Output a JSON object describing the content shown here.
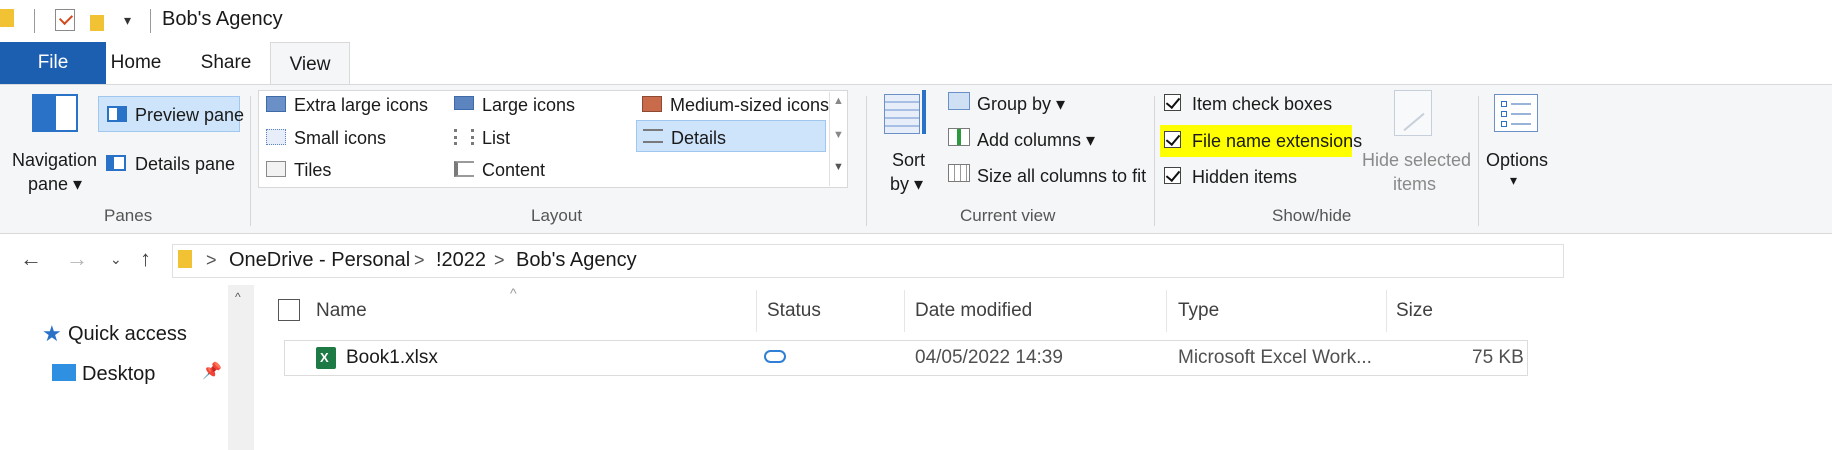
{
  "window": {
    "title": "Bob's Agency"
  },
  "quick_access_toolbar": {
    "dropdown_glyph": "▾"
  },
  "tabs": [
    {
      "label": "File"
    },
    {
      "label": "Home"
    },
    {
      "label": "Share"
    },
    {
      "label": "View"
    }
  ],
  "ribbon": {
    "panes": {
      "label": "Panes",
      "navigation_pane_line1": "Navigation",
      "navigation_pane_line2": "pane ▾",
      "preview_pane": "Preview pane",
      "details_pane": "Details pane"
    },
    "layout": {
      "label": "Layout",
      "items": [
        {
          "label": "Extra large icons"
        },
        {
          "label": "Large icons"
        },
        {
          "label": "Medium-sized icons"
        },
        {
          "label": "Small icons"
        },
        {
          "label": "List"
        },
        {
          "label": "Details",
          "selected": true
        },
        {
          "label": "Tiles"
        },
        {
          "label": "Content"
        }
      ]
    },
    "current_view": {
      "label": "Current view",
      "sort_by_line1": "Sort",
      "sort_by_line2": "by ▾",
      "group_by": "Group by ▾",
      "add_columns": "Add columns ▾",
      "size_all_columns": "Size all columns to fit"
    },
    "show_hide": {
      "label": "Show/hide",
      "item_check_boxes": "Item check boxes",
      "file_name_extensions": "File name extensions",
      "hidden_items": "Hidden items",
      "hide_selected_line1": "Hide selected",
      "hide_selected_line2": "items",
      "highlight_color": "#ffff00"
    },
    "options": {
      "label": "Options",
      "arrow": "▾"
    }
  },
  "address_bar": {
    "crumbs": [
      "OneDrive - Personal",
      "!2022",
      "Bob's Agency"
    ],
    "separator": ">"
  },
  "file_list": {
    "columns": [
      "Name",
      "Status",
      "Date modified",
      "Type",
      "Size"
    ],
    "rows": [
      {
        "name": "Book1.xlsx",
        "status_icon": "cloud-icon",
        "date_modified": "04/05/2022 14:39",
        "type": "Microsoft Excel Work...",
        "size": "75 KB"
      }
    ]
  },
  "sidebar": {
    "items": [
      {
        "label": "Quick access"
      },
      {
        "label": "Desktop"
      }
    ]
  },
  "colors": {
    "file_tab": "#1c5fb0",
    "selection": "#cde4fb",
    "folder": "#f1c233",
    "excel_green": "#1d7a45",
    "onedrive_blue": "#2f7fd6"
  }
}
